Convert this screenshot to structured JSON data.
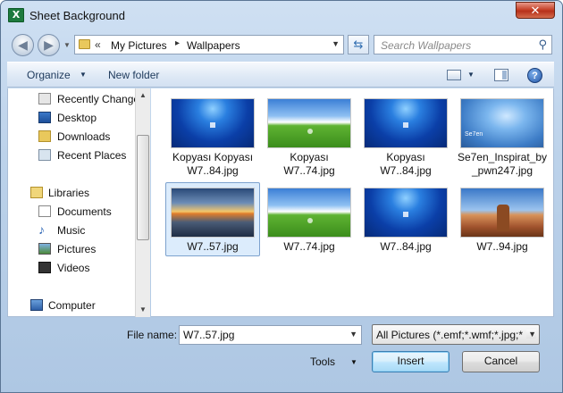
{
  "window": {
    "title": "Sheet Background",
    "app_icon": "X"
  },
  "address_bar": {
    "chevron": "«",
    "segments": [
      "My Pictures",
      "Wallpapers"
    ],
    "separator": "▸"
  },
  "search": {
    "placeholder": "Search Wallpapers"
  },
  "toolbar": {
    "organize_label": "Organize",
    "new_folder_label": "New folder"
  },
  "nav_pane": {
    "items": [
      {
        "label": "Recently Changed",
        "icon": "recent-icon"
      },
      {
        "label": "Desktop",
        "icon": "desktop-icon"
      },
      {
        "label": "Downloads",
        "icon": "downloads-icon"
      },
      {
        "label": "Recent Places",
        "icon": "recent-places-icon"
      },
      {
        "label": "Libraries",
        "icon": "libraries-icon"
      },
      {
        "label": "Documents",
        "icon": "documents-icon"
      },
      {
        "label": "Music",
        "icon": "music-icon"
      },
      {
        "label": "Pictures",
        "icon": "pictures-icon"
      },
      {
        "label": "Videos",
        "icon": "videos-icon"
      },
      {
        "label": "Computer",
        "icon": "computer-icon"
      }
    ]
  },
  "files": [
    {
      "name_line1": "Kopyası Kopyası",
      "name_line2": "W7..84.jpg",
      "thumb": "win7",
      "selected": false
    },
    {
      "name_line1": "Kopyası",
      "name_line2": "W7..74.jpg",
      "thumb": "xp",
      "selected": false
    },
    {
      "name_line1": "Kopyası",
      "name_line2": "W7..84.jpg",
      "thumb": "win7",
      "selected": false
    },
    {
      "name_line1": "Se7en_Inspirat_by",
      "name_line2": "_pwn247.jpg",
      "thumb": "blue",
      "selected": false
    },
    {
      "name_line1": "W7..57.jpg",
      "name_line2": "",
      "thumb": "sunset",
      "selected": true
    },
    {
      "name_line1": "W7..74.jpg",
      "name_line2": "",
      "thumb": "xp",
      "selected": false
    },
    {
      "name_line1": "W7..84.jpg",
      "name_line2": "",
      "thumb": "win7",
      "selected": false
    },
    {
      "name_line1": "W7..94.jpg",
      "name_line2": "",
      "thumb": "desert",
      "selected": false
    }
  ],
  "bottom": {
    "file_name_label": "File name:",
    "file_name_value": "W7..57.jpg",
    "file_type_value": "All Pictures (*.emf;*.wmf;*.jpg;*",
    "tools_label": "Tools",
    "insert_label": "Insert",
    "cancel_label": "Cancel"
  },
  "colors": {
    "selection": "#dcecfc",
    "frame": "#bcd2ea",
    "close": "#c7432b"
  }
}
